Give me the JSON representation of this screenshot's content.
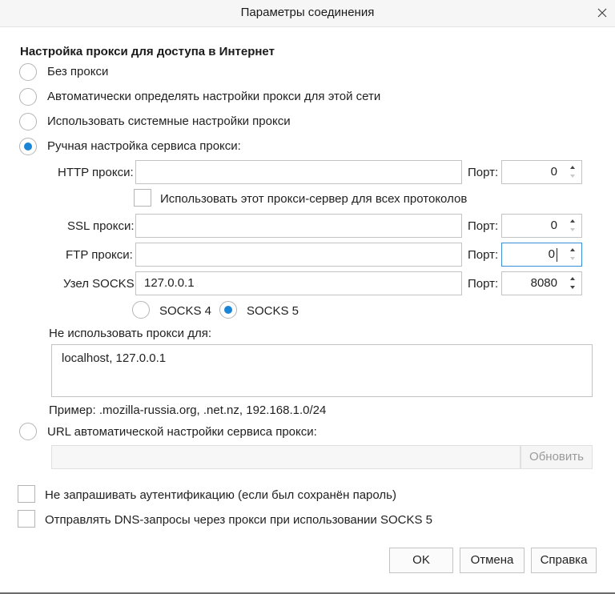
{
  "dialog": {
    "title": "Параметры соединения"
  },
  "proxy_section": {
    "heading": "Настройка прокси для доступа в Интернет",
    "options": [
      {
        "label": "Без прокси",
        "checked": false
      },
      {
        "label": "Автоматически определять настройки прокси для этой сети",
        "checked": false
      },
      {
        "label": "Использовать системные настройки прокси",
        "checked": false
      },
      {
        "label": "Ручная настройка сервиса прокси:",
        "checked": true
      }
    ]
  },
  "manual": {
    "http_label": "HTTP прокси:",
    "http_value": "",
    "http_port_label": "Порт:",
    "http_port": "0",
    "use_for_all_label": "Использовать этот прокси-сервер для всех протоколов",
    "ssl_label": "SSL прокси:",
    "ssl_value": "",
    "ssl_port_label": "Порт:",
    "ssl_port": "0",
    "ftp_label": "FTP прокси:",
    "ftp_value": "",
    "ftp_port_label": "Порт:",
    "ftp_port": "0",
    "socks_label": "Узел SOCKS:",
    "socks_value": "127.0.0.1",
    "socks_port_label": "Порт:",
    "socks_port": "8080",
    "socks4_label": "SOCKS 4",
    "socks5_label": "SOCKS 5",
    "socks_version_selected": "SOCKS 5"
  },
  "no_proxy": {
    "label": "Не использовать прокси для:",
    "value": "localhost, 127.0.0.1",
    "example": "Пример: .mozilla-russia.org, .net.nz, 192.168.1.0/24"
  },
  "auto_url": {
    "label": "URL автоматической настройки сервиса прокси:",
    "value": "",
    "reload_button": "Обновить"
  },
  "checkboxes": [
    {
      "label": "Не запрашивать аутентификацию (если был сохранён пароль)",
      "checked": false
    },
    {
      "label": "Отправлять DNS-запросы через прокси при использовании SOCKS 5",
      "checked": false
    }
  ],
  "buttons": {
    "ok": "OK",
    "cancel": "Отмена",
    "help": "Справка"
  },
  "colors": {
    "accent": "#1a84d6",
    "focus_border": "#3b8fd8"
  }
}
